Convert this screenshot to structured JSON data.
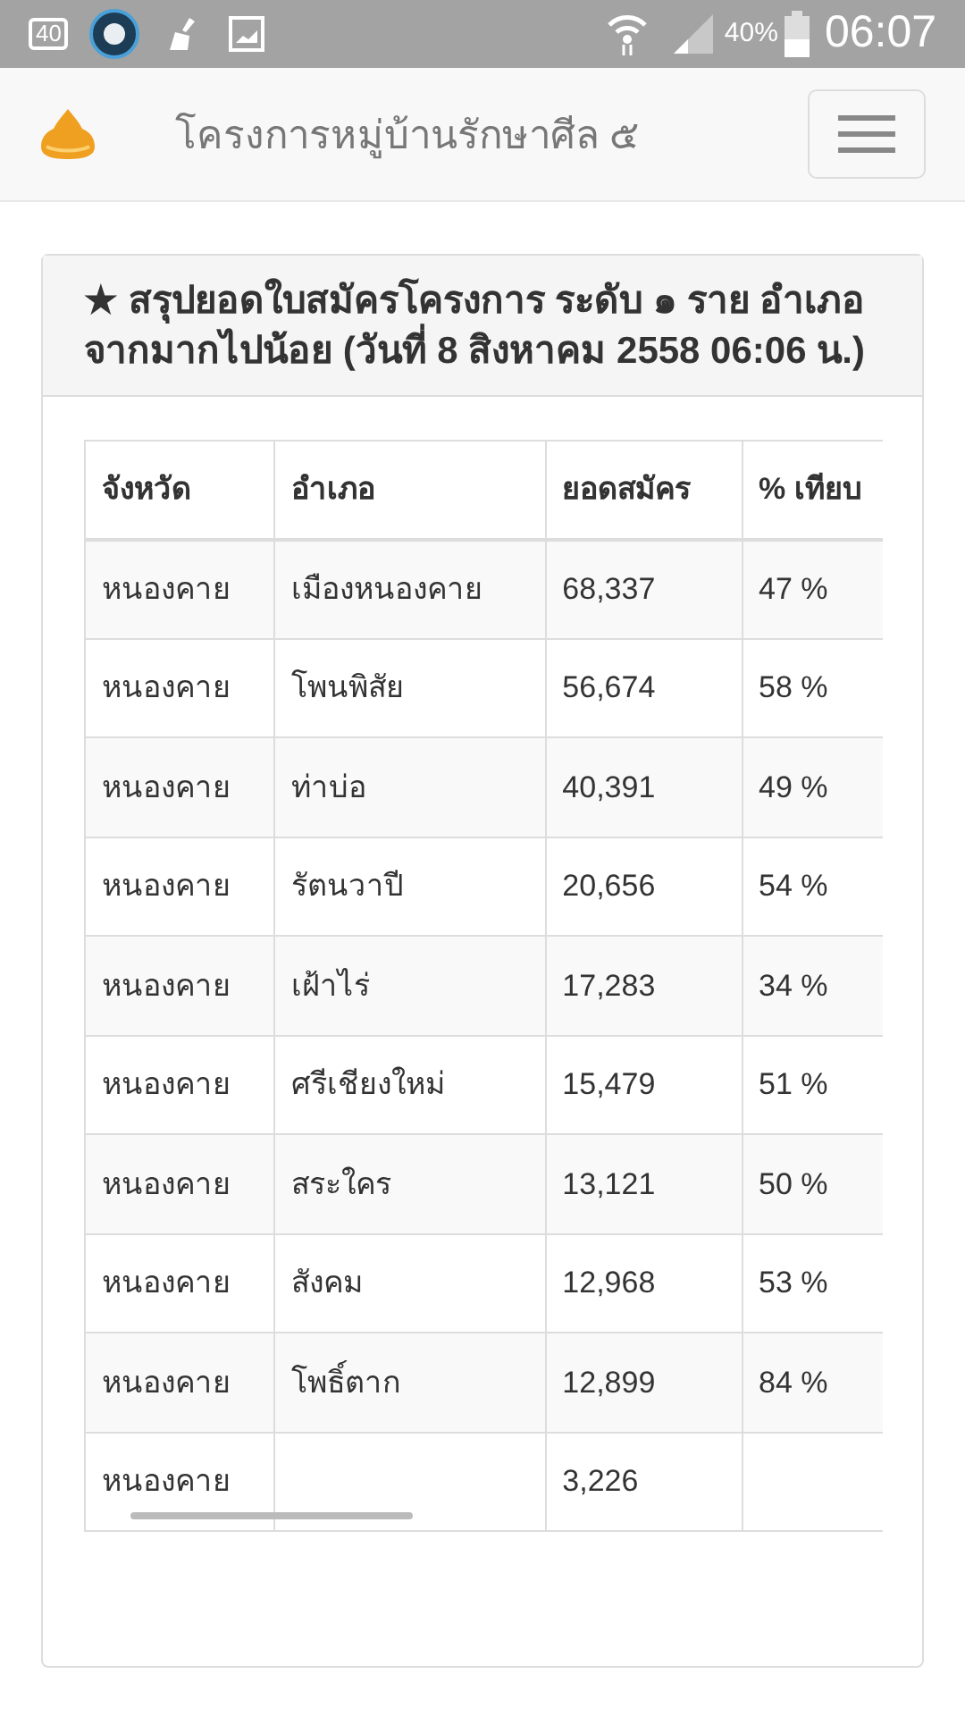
{
  "status_bar": {
    "left_badge": "40",
    "battery_percent": "40%",
    "time": "06:07"
  },
  "navbar": {
    "title": "โครงการหมู่บ้านรักษาศีล ๕"
  },
  "panel": {
    "heading": "★ สรุปยอดใบสมัครโครงการ ระดับ ๑ ราย อำเภอ จากมากไปน้อย (วันที่ 8 สิงหาคม 2558 06:06 น.)"
  },
  "table": {
    "columns": [
      "จังหวัด",
      "อำเภอ",
      "ยอดสมัคร",
      "% เทียบ"
    ],
    "rows": [
      {
        "province": "หนองคาย",
        "district": "เมืองหนองคาย",
        "applicants": "68,337",
        "percent": "47 %"
      },
      {
        "province": "หนองคาย",
        "district": "โพนพิสัย",
        "applicants": "56,674",
        "percent": "58 %"
      },
      {
        "province": "หนองคาย",
        "district": "ท่าบ่อ",
        "applicants": "40,391",
        "percent": "49 %"
      },
      {
        "province": "หนองคาย",
        "district": "รัตนวาปี",
        "applicants": "20,656",
        "percent": "54 %"
      },
      {
        "province": "หนองคาย",
        "district": "เฝ้าไร่",
        "applicants": "17,283",
        "percent": "34 %"
      },
      {
        "province": "หนองคาย",
        "district": "ศรีเชียงใหม่",
        "applicants": "15,479",
        "percent": "51 %"
      },
      {
        "province": "หนองคาย",
        "district": "สระใคร",
        "applicants": "13,121",
        "percent": "50 %"
      },
      {
        "province": "หนองคาย",
        "district": "สังคม",
        "applicants": "12,968",
        "percent": "53 %"
      },
      {
        "province": "หนองคาย",
        "district": "โพธิ์ตาก",
        "applicants": "12,899",
        "percent": "84 %"
      },
      {
        "province": "หนองคาย",
        "applicants": "3,226"
      }
    ]
  }
}
